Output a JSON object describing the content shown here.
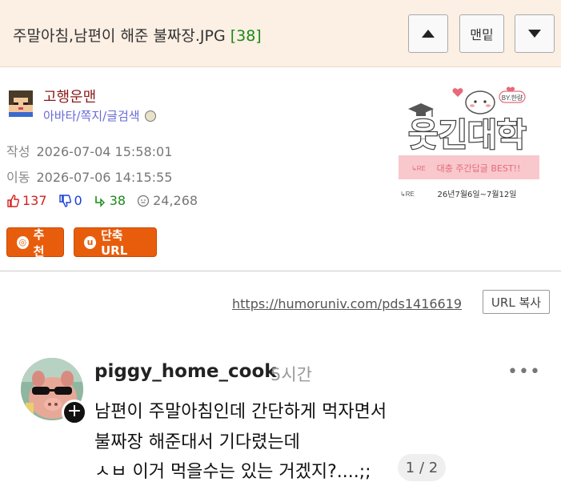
{
  "header": {
    "title": "주말아침,남편이 해준 불짜장.JPG",
    "reply_count": "[38]",
    "btn_up_icon": "triangle-up-icon",
    "btn_bottom_label": "맨밑",
    "btn_down_icon": "triangle-down-icon"
  },
  "author": {
    "name": "고행운맨",
    "links": [
      "아바타",
      "쪽지",
      "글검색"
    ],
    "link_sep": "/"
  },
  "meta": {
    "written_label": "작성",
    "written_value": "2026-07-04 15:58:01",
    "moved_label": "이동",
    "moved_value": "2026-07-06 14:15:55"
  },
  "stats": {
    "up": "137",
    "down": "0",
    "replies": "38",
    "views": "24,268",
    "colors": {
      "up": "#d42020",
      "down": "#1a3ed4",
      "replies": "#1a8a1a",
      "views": "#777777"
    }
  },
  "actions": {
    "recommend_label": "추천",
    "recommend_icon_glyph": "◎",
    "shorturl_label": "단축URL",
    "shorturl_icon_glyph": "u",
    "accent": "#e85d0c"
  },
  "logo": {
    "main_text": "웃긴대학",
    "by_text": "BY.한량",
    "banner_prefix": "↳RE",
    "banner_text": "대충 주간답글 BEST!!",
    "date_prefix": "↳RE",
    "date_text": "26년7월6일~7월12일"
  },
  "share": {
    "url": "https://humoruniv.com/pds1416619",
    "copy_label": "URL 복사"
  },
  "embed": {
    "username": "piggy_home_cook",
    "time_ago": "5시간",
    "more": "•••",
    "plus": "+",
    "lines": [
      "남편이  주말아침인데 간단하게 먹자면서",
      "불짜장 해준대서 기다렸는데",
      "ㅅㅂ 이거 먹을수는 있는 거겠지?....;;"
    ],
    "page": "1 / 2"
  }
}
